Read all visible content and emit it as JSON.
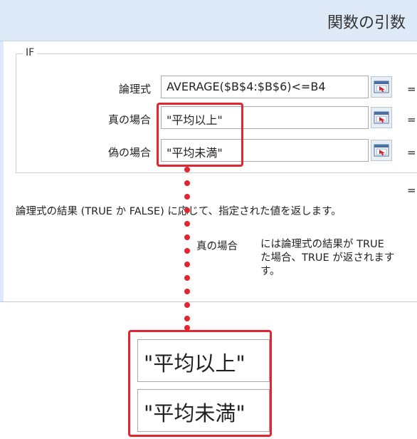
{
  "dialog": {
    "title": "関数の引数",
    "function_name": "IF",
    "args": [
      {
        "label": "論理式",
        "value": "AVERAGE($B$4:$B$6)<=B4",
        "eq": "="
      },
      {
        "label": "真の場合",
        "value": "\"平均以上\"",
        "eq": "="
      },
      {
        "label": "偽の場合",
        "value": "\"平均未満\"",
        "eq": "="
      }
    ],
    "result_eq": "=",
    "description": "論理式の結果 (TRUE か FALSE) に応じて、指定された値を返します。",
    "detail_label": "真の場合",
    "detail_text": "には論理式の結果が TRUE\nた場合、TRUE が返されます\nす。"
  },
  "zoom": {
    "values": [
      "\"平均以上\"",
      "\"平均未満\""
    ]
  },
  "colors": {
    "highlight": "#e32530",
    "titlebar": "#dde9f6"
  },
  "icons": {
    "ref_button": "range-select-icon"
  }
}
